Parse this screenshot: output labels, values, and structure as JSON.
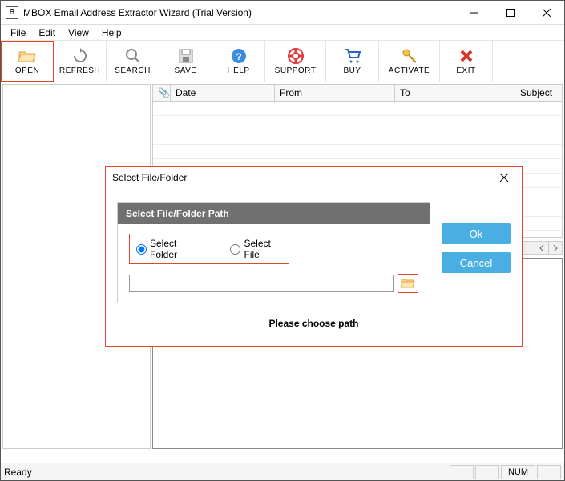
{
  "window": {
    "title": "MBOX Email Address Extractor Wizard (Trial Version)"
  },
  "menu": {
    "file": "File",
    "edit": "Edit",
    "view": "View",
    "help": "Help"
  },
  "toolbar": {
    "open": "OPEN",
    "refresh": "REFRESH",
    "search": "SEARCH",
    "save": "SAVE",
    "help": "HELP",
    "support": "SUPPORT",
    "buy": "BUY",
    "activate": "ACTIVATE",
    "exit": "EXIT"
  },
  "grid": {
    "attach": "📎",
    "date": "Date",
    "from": "From",
    "to": "To",
    "subject": "Subject"
  },
  "status": {
    "ready": "Ready",
    "num": "NUM"
  },
  "dialog": {
    "title": "Select File/Folder",
    "header": "Select File/Folder Path",
    "radio_folder": "Select Folder",
    "radio_file": "Select File",
    "path_value": "",
    "ok": "Ok",
    "cancel": "Cancel",
    "footer": "Please choose path"
  }
}
